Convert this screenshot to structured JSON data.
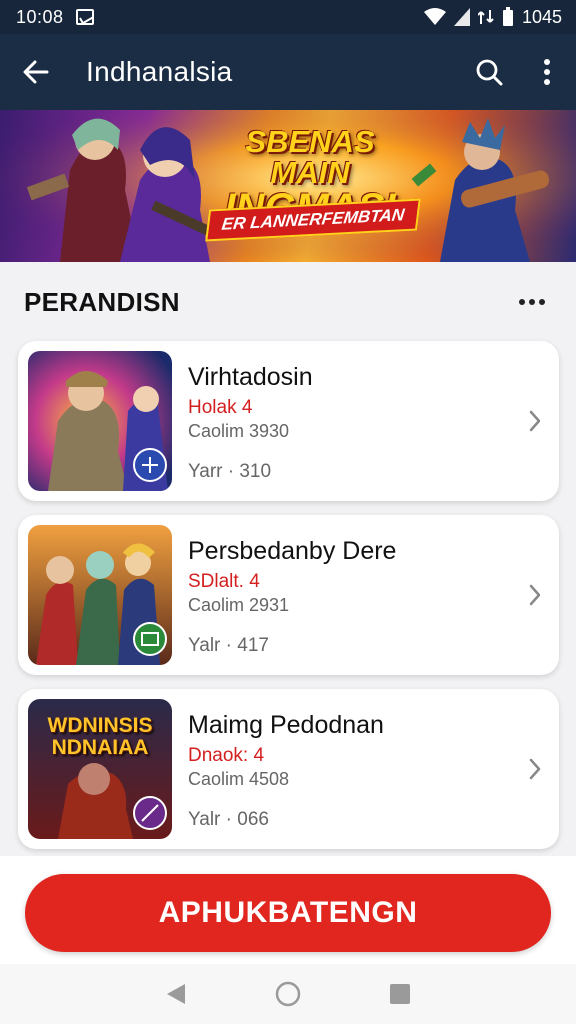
{
  "status_bar": {
    "time": "10:08",
    "battery_text": "1045"
  },
  "app_bar": {
    "title": "Indhanalsia"
  },
  "banner": {
    "headline_line1": "SBENAS MAIN",
    "headline_line2": "INGMASI",
    "subtitle": "ER LANNERFEMBTAN"
  },
  "section": {
    "title": "PERANDISN"
  },
  "games": [
    {
      "name": "Virhtadosin",
      "tag": "Holak 4",
      "meta": "Caolim 3930",
      "stat": "Yarr · 310"
    },
    {
      "name": "Persbedanby Dere",
      "tag": "SDlalt. 4",
      "meta": "Caolim 2931",
      "stat": "Yalr · 417"
    },
    {
      "name": "Maimg Pedodnan",
      "tag": "Dnaok: 4",
      "meta": "Caolim 4508",
      "stat": "Yalr · 066",
      "thumb_text_line1": "WDNINSIS",
      "thumb_text_line2": "NDNAIAA"
    }
  ],
  "cta": {
    "label": "APHUKBATENGN"
  },
  "colors": {
    "app_bar": "#1b2d45",
    "accent_red": "#e0261f",
    "tag_red": "#d41f1f"
  },
  "icons": [
    "back-arrow-icon",
    "search-icon",
    "more-vert-icon",
    "more-horiz-icon",
    "chevron-right-icon",
    "nav-back-icon",
    "nav-home-icon",
    "nav-recents-icon"
  ]
}
